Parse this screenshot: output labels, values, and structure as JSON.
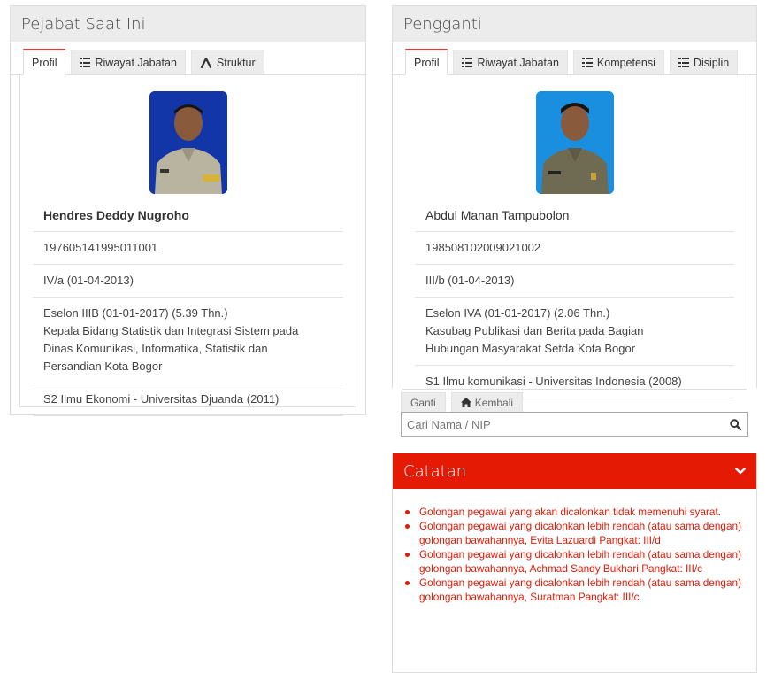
{
  "left": {
    "title": "Pejabat Saat Ini",
    "tabs": [
      {
        "label": "Profil",
        "icon": "none"
      },
      {
        "label": "Riwayat Jabatan",
        "icon": "list-icon"
      },
      {
        "label": "Struktur",
        "icon": "sitemap-icon"
      }
    ],
    "name": "Hendres Deddy Nugroho",
    "nip": "197605141995011001",
    "golongan": "IV/a (01-04-2013)",
    "eselon": "Eselon IIIB (01-01-2017) (5.39 Thn.)",
    "jabatan_lines": [
      "Kepala Bidang Statistik dan Integrasi Sistem pada",
      "Dinas Komunikasi, Informatika, Statistik dan",
      "Persandian Kota Bogor"
    ],
    "pendidikan": "S2 Ilmu Ekonomi - Universitas Djuanda (2011)"
  },
  "right": {
    "title": "Pengganti",
    "tabs": [
      {
        "label": "Profil",
        "icon": "none"
      },
      {
        "label": "Riwayat Jabatan",
        "icon": "list-icon"
      },
      {
        "label": "Kompetensi",
        "icon": "list-icon"
      },
      {
        "label": "Disiplin",
        "icon": "list-icon"
      }
    ],
    "name": "Abdul Manan Tampubolon",
    "nip": "198508102009021002",
    "golongan": "III/b (01-04-2013)",
    "eselon": "Eselon IVA (01-01-2017) (2.06 Thn.)",
    "jabatan_lines": [
      "Kasubag Publikasi dan Berita pada Bagian",
      "Hubungan Masyarakat Setda Kota Bogor"
    ],
    "pendidikan": "S1 Ilmu komunikasi - Universitas Indonesia (2008)"
  },
  "search": {
    "tab_ganti": "Ganti",
    "tab_kembali": "Kembali",
    "placeholder": "Cari Nama / NIP"
  },
  "notes": {
    "title": "Catatan",
    "items": [
      "Golongan pegawai yang akan dicalonkan tidak memenuhi syarat.",
      "Golongan pegawai yang dicalonkan lebih rendah (atau sama dengan) golongan bawahannya, Evita Lazuardi Pangkat: III/d",
      "Golongan pegawai yang dicalonkan lebih rendah (atau sama dengan) golongan bawahannya, Achmad Sandy Bukhari Pangkat: III/c",
      "Golongan pegawai yang dicalonkan lebih rendah (atau sama dengan) golongan bawahannya, Suratman Pangkat: III/c"
    ],
    "color": "#e41a05"
  },
  "colors": {
    "accent": "#dd3a3a",
    "photo_background": "#1236a8",
    "header_bg": "#ececec"
  }
}
